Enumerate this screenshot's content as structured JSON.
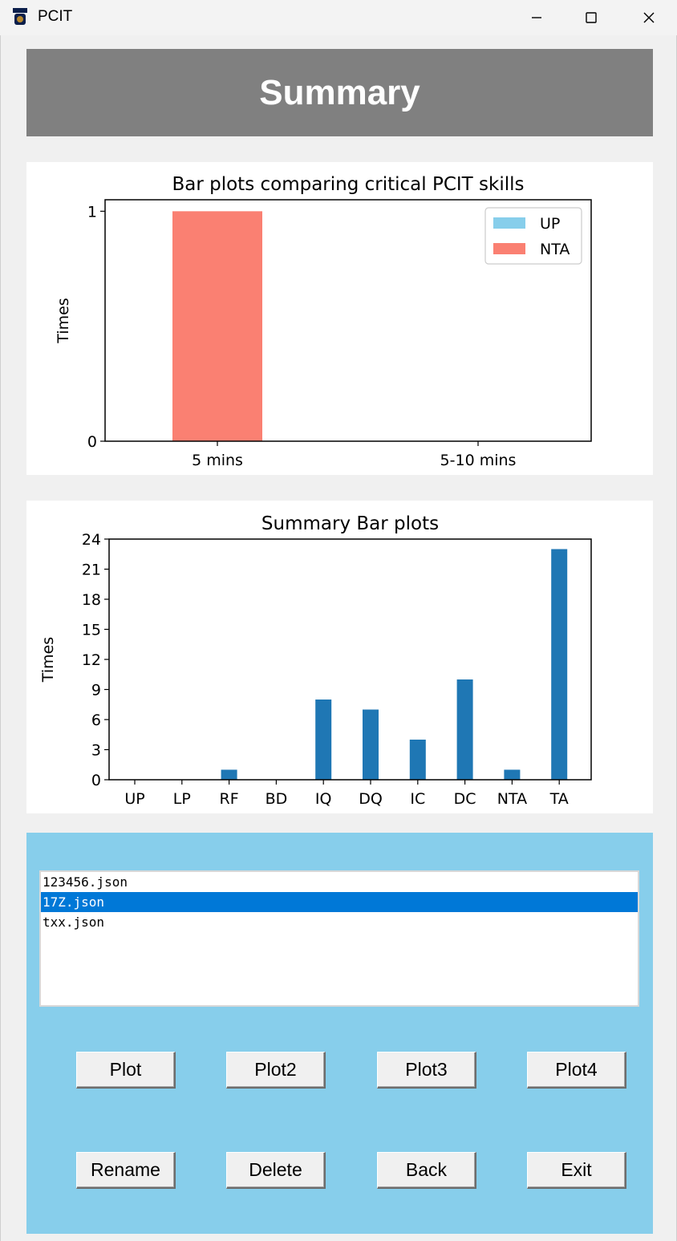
{
  "window": {
    "title": "PCIT",
    "icon": "fiu-logo-icon",
    "controls": [
      "minimize-icon",
      "maximize-icon",
      "close-icon"
    ]
  },
  "header": {
    "title": "Summary"
  },
  "charts": [
    {
      "type": "bar",
      "title": "Bar plots comparing critical PCIT skills",
      "ylabel": "Times",
      "categories": [
        "5 mins",
        "5-10 mins"
      ],
      "series": [
        {
          "name": "UP",
          "values": [
            0,
            0
          ],
          "color": "#87ceeb"
        },
        {
          "name": "NTA",
          "values": [
            1,
            0
          ],
          "color": "#fa8072"
        }
      ],
      "yticks": [
        "0",
        "1"
      ],
      "ylim": [
        0,
        1.05
      ],
      "legend": "top-right"
    },
    {
      "type": "bar",
      "title": "Summary Bar plots",
      "ylabel": "Times",
      "categories": [
        "UP",
        "LP",
        "RF",
        "BD",
        "IQ",
        "DQ",
        "IC",
        "DC",
        "NTA",
        "TA"
      ],
      "values": [
        0,
        0,
        1,
        0,
        8,
        7,
        4,
        10,
        1,
        23
      ],
      "color": "#1f77b4",
      "yticks": [
        "0",
        "3",
        "6",
        "9",
        "12",
        "15",
        "18",
        "21",
        "24"
      ],
      "ylim": [
        0,
        24
      ]
    }
  ],
  "files": {
    "items": [
      "123456.json",
      "17Z.json",
      "txx.json"
    ],
    "selected_index": 1
  },
  "buttons": {
    "plot": "Plot",
    "plot2": "Plot2",
    "plot3": "Plot3",
    "plot4": "Plot4",
    "rename": "Rename",
    "delete": "Delete",
    "back": "Back",
    "exit": "Exit"
  }
}
